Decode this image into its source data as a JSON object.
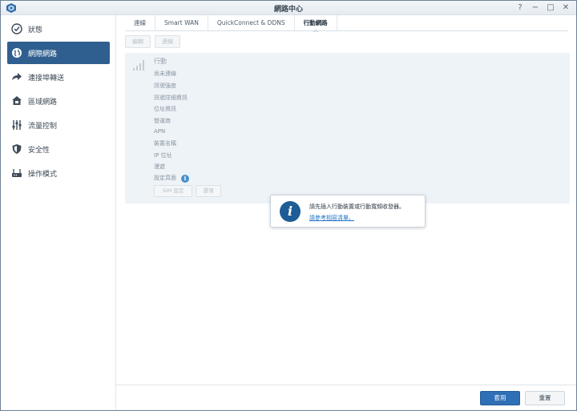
{
  "window": {
    "title": "網路中心",
    "controls": [
      "?",
      "−",
      "□",
      "✕"
    ]
  },
  "sidebar": {
    "items": [
      {
        "label": "狀態",
        "icon": "status-icon"
      },
      {
        "label": "網際網路",
        "icon": "globe-icon",
        "active": true
      },
      {
        "label": "連接埠轉送",
        "icon": "port-forward-icon"
      },
      {
        "label": "區域網路",
        "icon": "lan-icon"
      },
      {
        "label": "流量控制",
        "icon": "traffic-control-icon"
      },
      {
        "label": "安全性",
        "icon": "shield-icon"
      },
      {
        "label": "操作模式",
        "icon": "router-icon"
      }
    ]
  },
  "tabs": [
    {
      "label": "連線"
    },
    {
      "label": "Smart WAN"
    },
    {
      "label": "QuickConnect & DDNS"
    },
    {
      "label": "行動網路",
      "active": true
    }
  ],
  "toolbar": {
    "edit_label": "編輯",
    "connect_label": "連線"
  },
  "mobile": {
    "heading": "行動",
    "status": "尚未連線",
    "fields": [
      "訊號強度",
      "訊號詳細資訊",
      "位址資訊",
      "營運商",
      "APN",
      "裝置名稱",
      "IP 位址",
      "漫遊",
      "設定頁面"
    ],
    "sim_button": "SIM 設定",
    "options_button": "選項"
  },
  "popup": {
    "message": "請先插入行動裝置或行動寬頻收發器。",
    "link": "請參考相容清單。"
  },
  "footer": {
    "apply_label": "套用",
    "reset_label": "重置"
  },
  "colors": {
    "accent": "#2f5f8f",
    "apply": "#2e6fb5",
    "link": "#1f73c7"
  }
}
